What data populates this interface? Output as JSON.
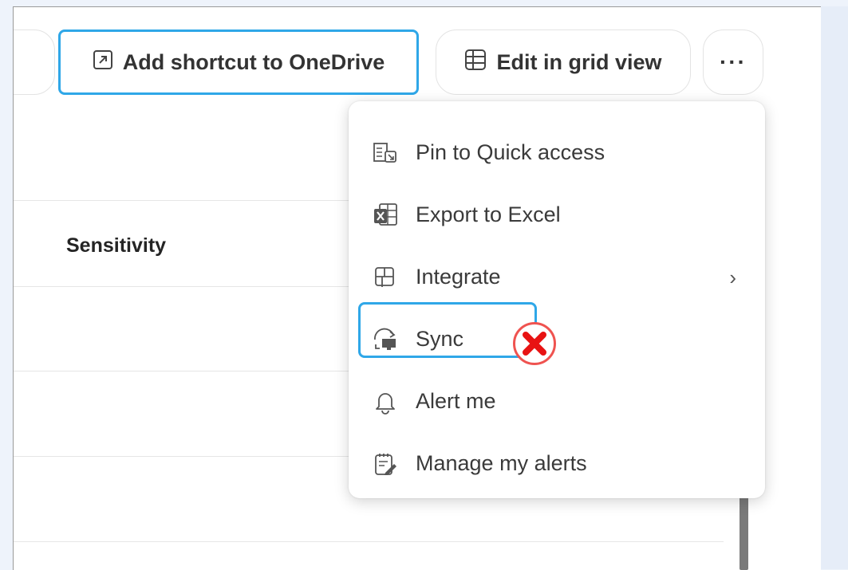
{
  "toolbar": {
    "add_shortcut_label": "Add shortcut to OneDrive",
    "edit_grid_label": "Edit in grid view",
    "more_label": "···"
  },
  "table": {
    "column_header": "Sensitivity"
  },
  "menu": {
    "items": [
      {
        "label": "Pin to Quick access",
        "icon": "pin-quick-access-icon"
      },
      {
        "label": "Export to Excel",
        "icon": "excel-icon"
      },
      {
        "label": "Integrate",
        "icon": "integrate-icon",
        "submenu": true,
        "chevron": "›"
      },
      {
        "label": "Sync",
        "icon": "sync-icon"
      },
      {
        "label": "Alert me",
        "icon": "bell-icon"
      },
      {
        "label": "Manage my alerts",
        "icon": "manage-alerts-icon"
      }
    ]
  },
  "colors": {
    "highlight": "#2fa7e8",
    "marker": "#ef5350",
    "excel_green": "#1e7145"
  }
}
